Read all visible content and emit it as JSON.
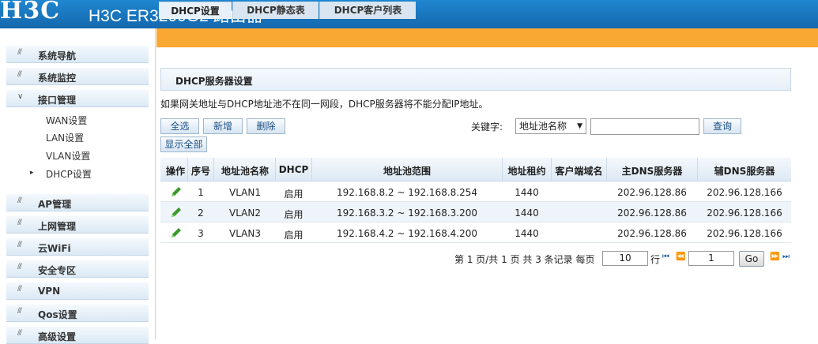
{
  "header": {
    "logo": "H3C",
    "product": "H3C ER3200G2 路由器"
  },
  "sidebar": {
    "items": [
      {
        "label": "系统导航",
        "expanded": false
      },
      {
        "label": "系统监控",
        "expanded": false
      },
      {
        "label": "接口管理",
        "expanded": true
      },
      {
        "label": "AP管理",
        "expanded": false
      },
      {
        "label": "上网管理",
        "expanded": false
      },
      {
        "label": "云WiFi",
        "expanded": false
      },
      {
        "label": "安全专区",
        "expanded": false
      },
      {
        "label": "VPN",
        "expanded": false
      },
      {
        "label": "Qos设置",
        "expanded": false
      },
      {
        "label": "高级设置",
        "expanded": false
      }
    ],
    "subitems": [
      "WAN设置",
      "LAN设置",
      "VLAN设置",
      "DHCP设置"
    ],
    "active_subitem": "DHCP设置"
  },
  "tabs": [
    {
      "label": "DHCP设置",
      "active": true
    },
    {
      "label": "DHCP静态表",
      "active": false
    },
    {
      "label": "DHCP客户列表",
      "active": false
    }
  ],
  "panel": {
    "title": "DHCP服务器设置",
    "notice": "如果网关地址与DHCP地址池不在同一网段，DHCP服务器将不能分配IP地址。"
  },
  "toolbar": {
    "select_all": "全选",
    "add": "新增",
    "delete": "删除",
    "show_all": "显示全部",
    "keyword_label": "关键字:",
    "keyword_option": "地址池名称",
    "search_value": "",
    "query": "查询"
  },
  "table": {
    "headers": [
      "操作",
      "序号",
      "地址池名称",
      "DHCP",
      "地址池范围",
      "地址租约",
      "客户端域名",
      "主DNS服务器",
      "辅DNS服务器"
    ],
    "rows": [
      {
        "index": "1",
        "name": "VLAN1",
        "dhcp": "启用",
        "range": "192.168.8.2 ~ 192.168.8.254",
        "lease": "1440",
        "domain": "",
        "dns1": "202.96.128.86",
        "dns2": "202.96.128.166"
      },
      {
        "index": "2",
        "name": "VLAN2",
        "dhcp": "启用",
        "range": "192.168.3.2 ~ 192.168.3.200",
        "lease": "1440",
        "domain": "",
        "dns1": "202.96.128.86",
        "dns2": "202.96.128.166"
      },
      {
        "index": "3",
        "name": "VLAN3",
        "dhcp": "启用",
        "range": "192.168.4.2 ~ 192.168.4.200",
        "lease": "1440",
        "domain": "",
        "dns1": "202.96.128.86",
        "dns2": "202.96.128.166"
      }
    ]
  },
  "pager": {
    "summary": "第 1 页/共 1 页 共 3 条记录 每页",
    "per_page": "10",
    "rows_label": "行",
    "page": "1",
    "go": "Go"
  },
  "colors": {
    "header_blue": "#1a78c2",
    "tab_orange": "#f8a833",
    "edit_green": "#3a9a2a"
  }
}
